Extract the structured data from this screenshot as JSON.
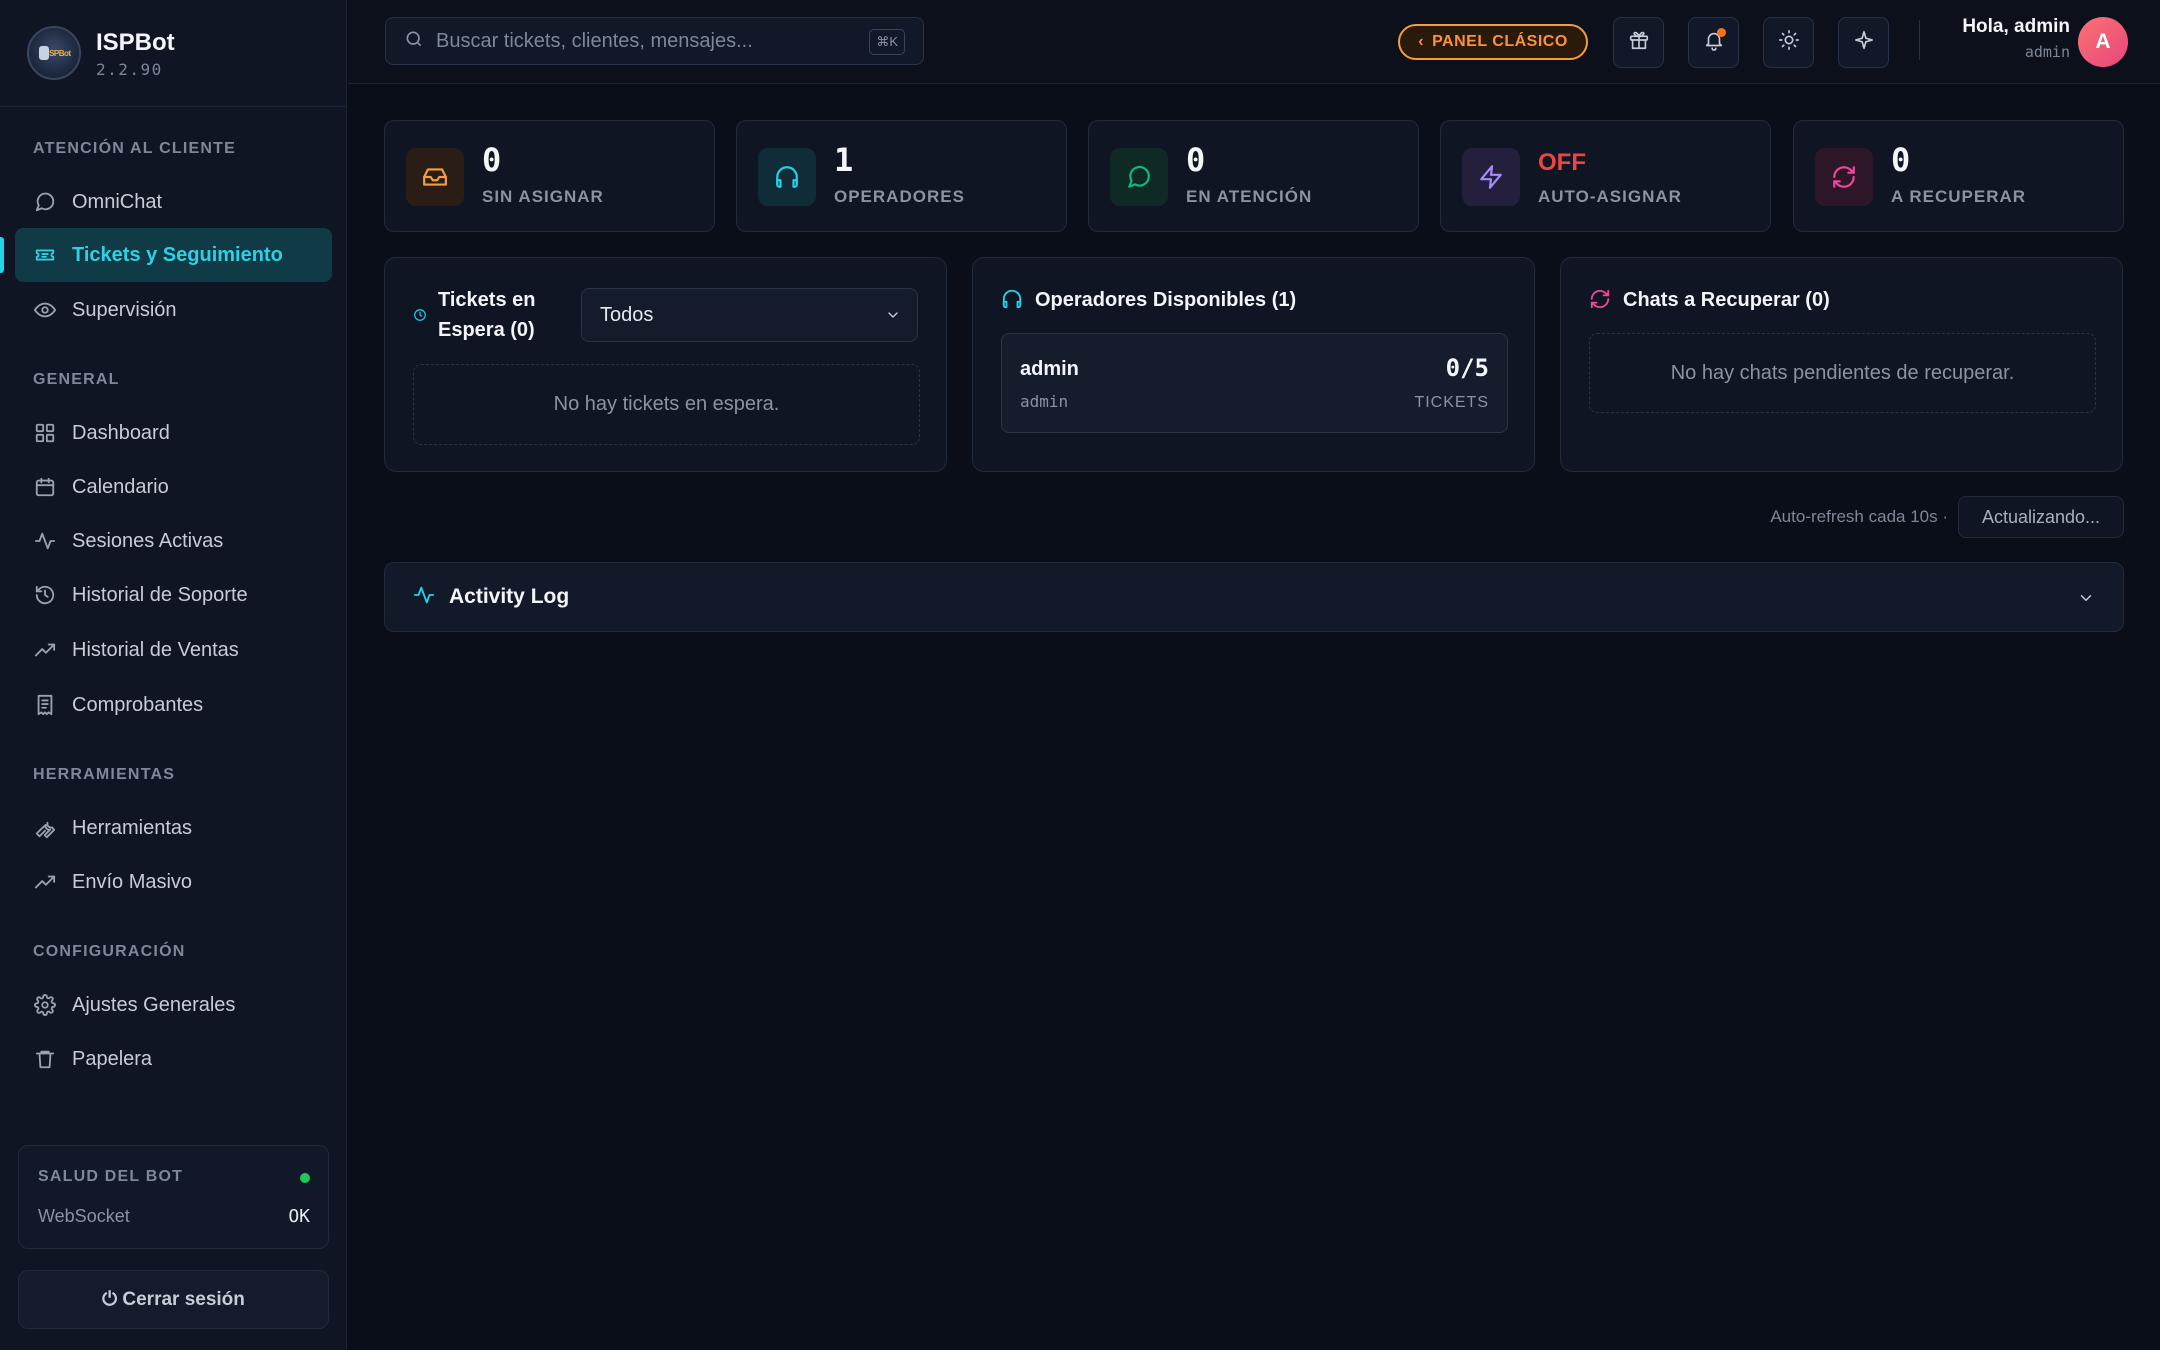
{
  "app": {
    "name": "ISPBot",
    "version": "2.2.90",
    "logo_text": "ISPBot"
  },
  "sidebar": {
    "sections": [
      {
        "label": "ATENCIÓN AL CLIENTE",
        "items": [
          {
            "label": "OmniChat",
            "icon": "chat-bubble-icon"
          },
          {
            "label": "Tickets y Seguimiento",
            "icon": "ticket-icon",
            "active": true
          },
          {
            "label": "Supervisión",
            "icon": "eye-icon"
          }
        ]
      },
      {
        "label": "GENERAL",
        "items": [
          {
            "label": "Dashboard",
            "icon": "grid-icon"
          },
          {
            "label": "Calendario",
            "icon": "calendar-icon"
          },
          {
            "label": "Sesiones Activas",
            "icon": "activity-icon"
          },
          {
            "label": "Historial de Soporte",
            "icon": "history-icon"
          },
          {
            "label": "Historial de Ventas",
            "icon": "trending-up-icon"
          },
          {
            "label": "Comprobantes",
            "icon": "receipt-icon"
          }
        ]
      },
      {
        "label": "HERRAMIENTAS",
        "items": [
          {
            "label": "Herramientas",
            "icon": "wrench-icon"
          },
          {
            "label": "Envío Masivo",
            "icon": "trending-up-icon"
          }
        ]
      },
      {
        "label": "CONFIGURACIÓN",
        "items": [
          {
            "label": "Ajustes Generales",
            "icon": "gear-icon"
          },
          {
            "label": "Papelera",
            "icon": "trash-icon"
          }
        ]
      }
    ],
    "health": {
      "title": "SALUD DEL BOT",
      "status_color": "#22c55e",
      "row_label": "WebSocket",
      "row_value": "OK"
    },
    "logout_label": "⏻ Cerrar sesión"
  },
  "topbar": {
    "search_placeholder": "Buscar tickets, clientes, mensajes...",
    "search_shortcut": "⌘K",
    "classic_panel_label": "PANEL CLÁSICO",
    "greeting": "Hola, admin",
    "role": "admin",
    "avatar_initial": "A",
    "notification_dot_color": "#f97316"
  },
  "stats": [
    {
      "value": "0",
      "label": "SIN ASIGNAR",
      "icon": "inbox-icon",
      "color": "#f59e3b"
    },
    {
      "value": "1",
      "label": "OPERADORES",
      "icon": "headphones-icon",
      "color": "#22d3ee"
    },
    {
      "value": "0",
      "label": "EN ATENCIÓN",
      "icon": "chat-bubble-icon",
      "color": "#10b981"
    },
    {
      "value": "OFF",
      "label": "AUTO-ASIGNAR",
      "icon": "lightning-icon",
      "color": "#a78bfa",
      "value_color": "#ef4444"
    },
    {
      "value": "0",
      "label": "A RECUPERAR",
      "icon": "refresh-icon",
      "color": "#ec4899"
    }
  ],
  "panels": {
    "waiting": {
      "title": "Tickets en Espera (0)",
      "filter_value": "Todos",
      "empty_text": "No hay tickets en espera."
    },
    "operators": {
      "title": "Operadores Disponibles (1)",
      "operators": [
        {
          "name": "admin",
          "username": "admin",
          "count": "0/5",
          "unit": "TICKETS"
        }
      ]
    },
    "recover": {
      "title": "Chats a Recuperar (0)",
      "empty_text": "No hay chats pendientes de recuperar."
    }
  },
  "refresh": {
    "text": "Auto-refresh cada 10s ·",
    "button_label": "Actualizando..."
  },
  "activity_log": {
    "title": "Activity Log"
  }
}
